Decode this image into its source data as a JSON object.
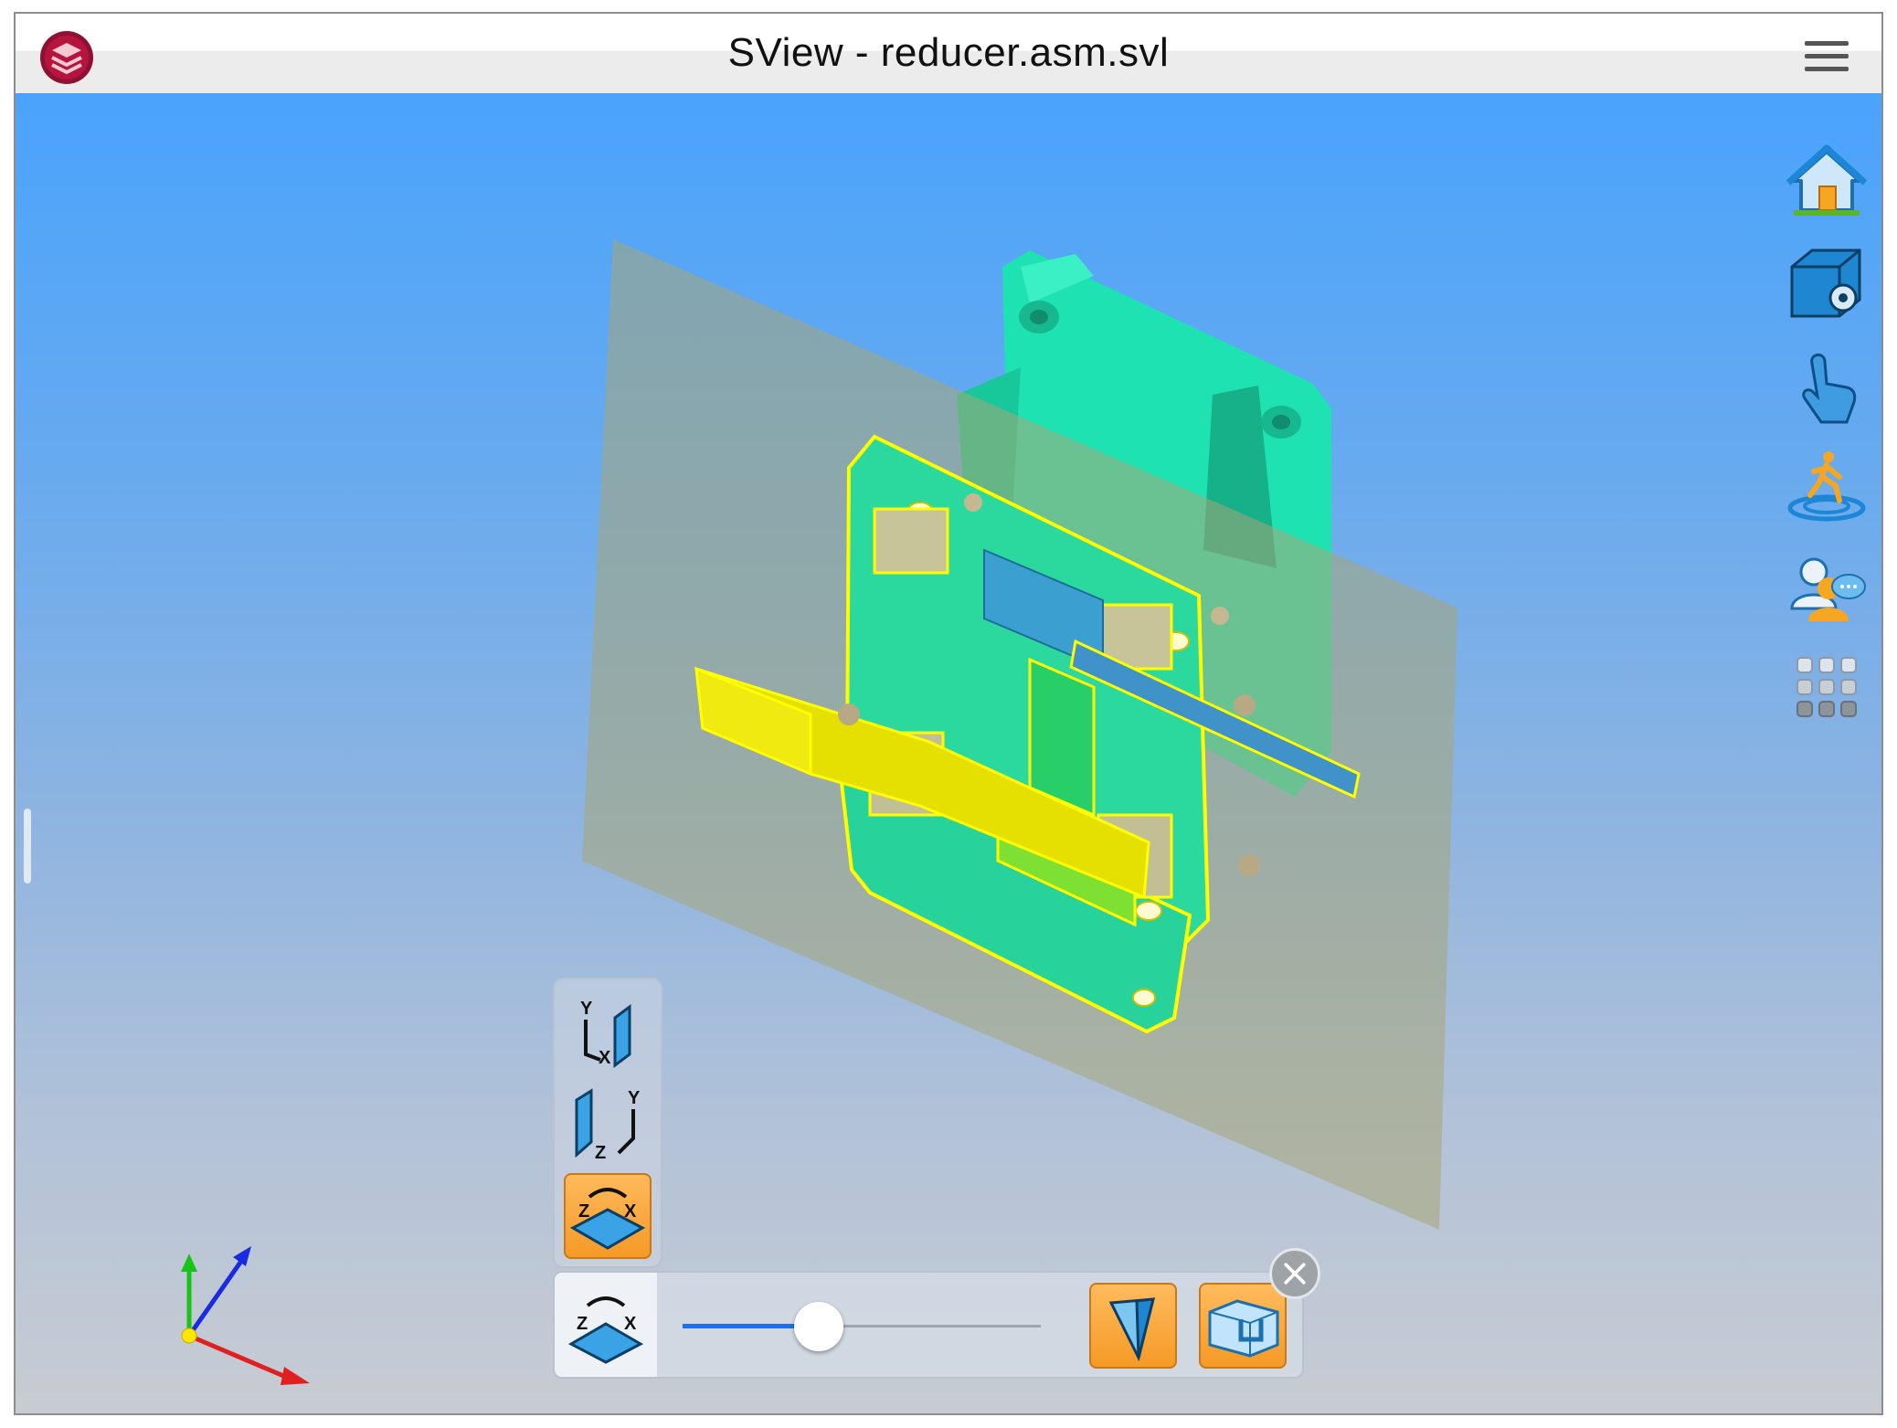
{
  "window": {
    "title": "SView - reducer.asm.svl",
    "logo": "sview-logo",
    "menu_icon": "hamburger-menu-icon"
  },
  "right_toolbar": [
    {
      "icon": "home-icon"
    },
    {
      "icon": "model-settings-icon"
    },
    {
      "icon": "touch-gesture-icon"
    },
    {
      "icon": "walkthrough-icon"
    },
    {
      "icon": "collaboration-icon"
    },
    {
      "icon": "apps-grid-icon"
    }
  ],
  "section_planes": [
    {
      "icon": "plane-xy-icon",
      "axis_labels": [
        "Y",
        "X"
      ],
      "active": false
    },
    {
      "icon": "plane-yz-icon",
      "axis_labels": [
        "Z",
        "Y"
      ],
      "active": false
    },
    {
      "icon": "plane-zx-icon",
      "axis_labels": [
        "Z",
        "X"
      ],
      "active": true
    }
  ],
  "section_slider": {
    "current_plane_icon": "plane-zx-icon",
    "current_plane_labels": [
      "Z",
      "X"
    ],
    "position": 0.38,
    "actions": [
      {
        "icon": "reverse-section-icon"
      },
      {
        "icon": "section-cap-icon"
      }
    ]
  },
  "colors": {
    "viewport_top": "#4aa3fc",
    "viewport_bottom": "#c8ccd2",
    "housing": "#1ee8b4",
    "section_outline": "#ffff00",
    "shaft": "#e8e000",
    "cut_plane": "#a8a880",
    "active_button": "#f59a26"
  },
  "triad": {
    "x_axis_color": "#e02020",
    "y_axis_color": "#18c418",
    "z_axis_color": "#1a2ae0"
  }
}
